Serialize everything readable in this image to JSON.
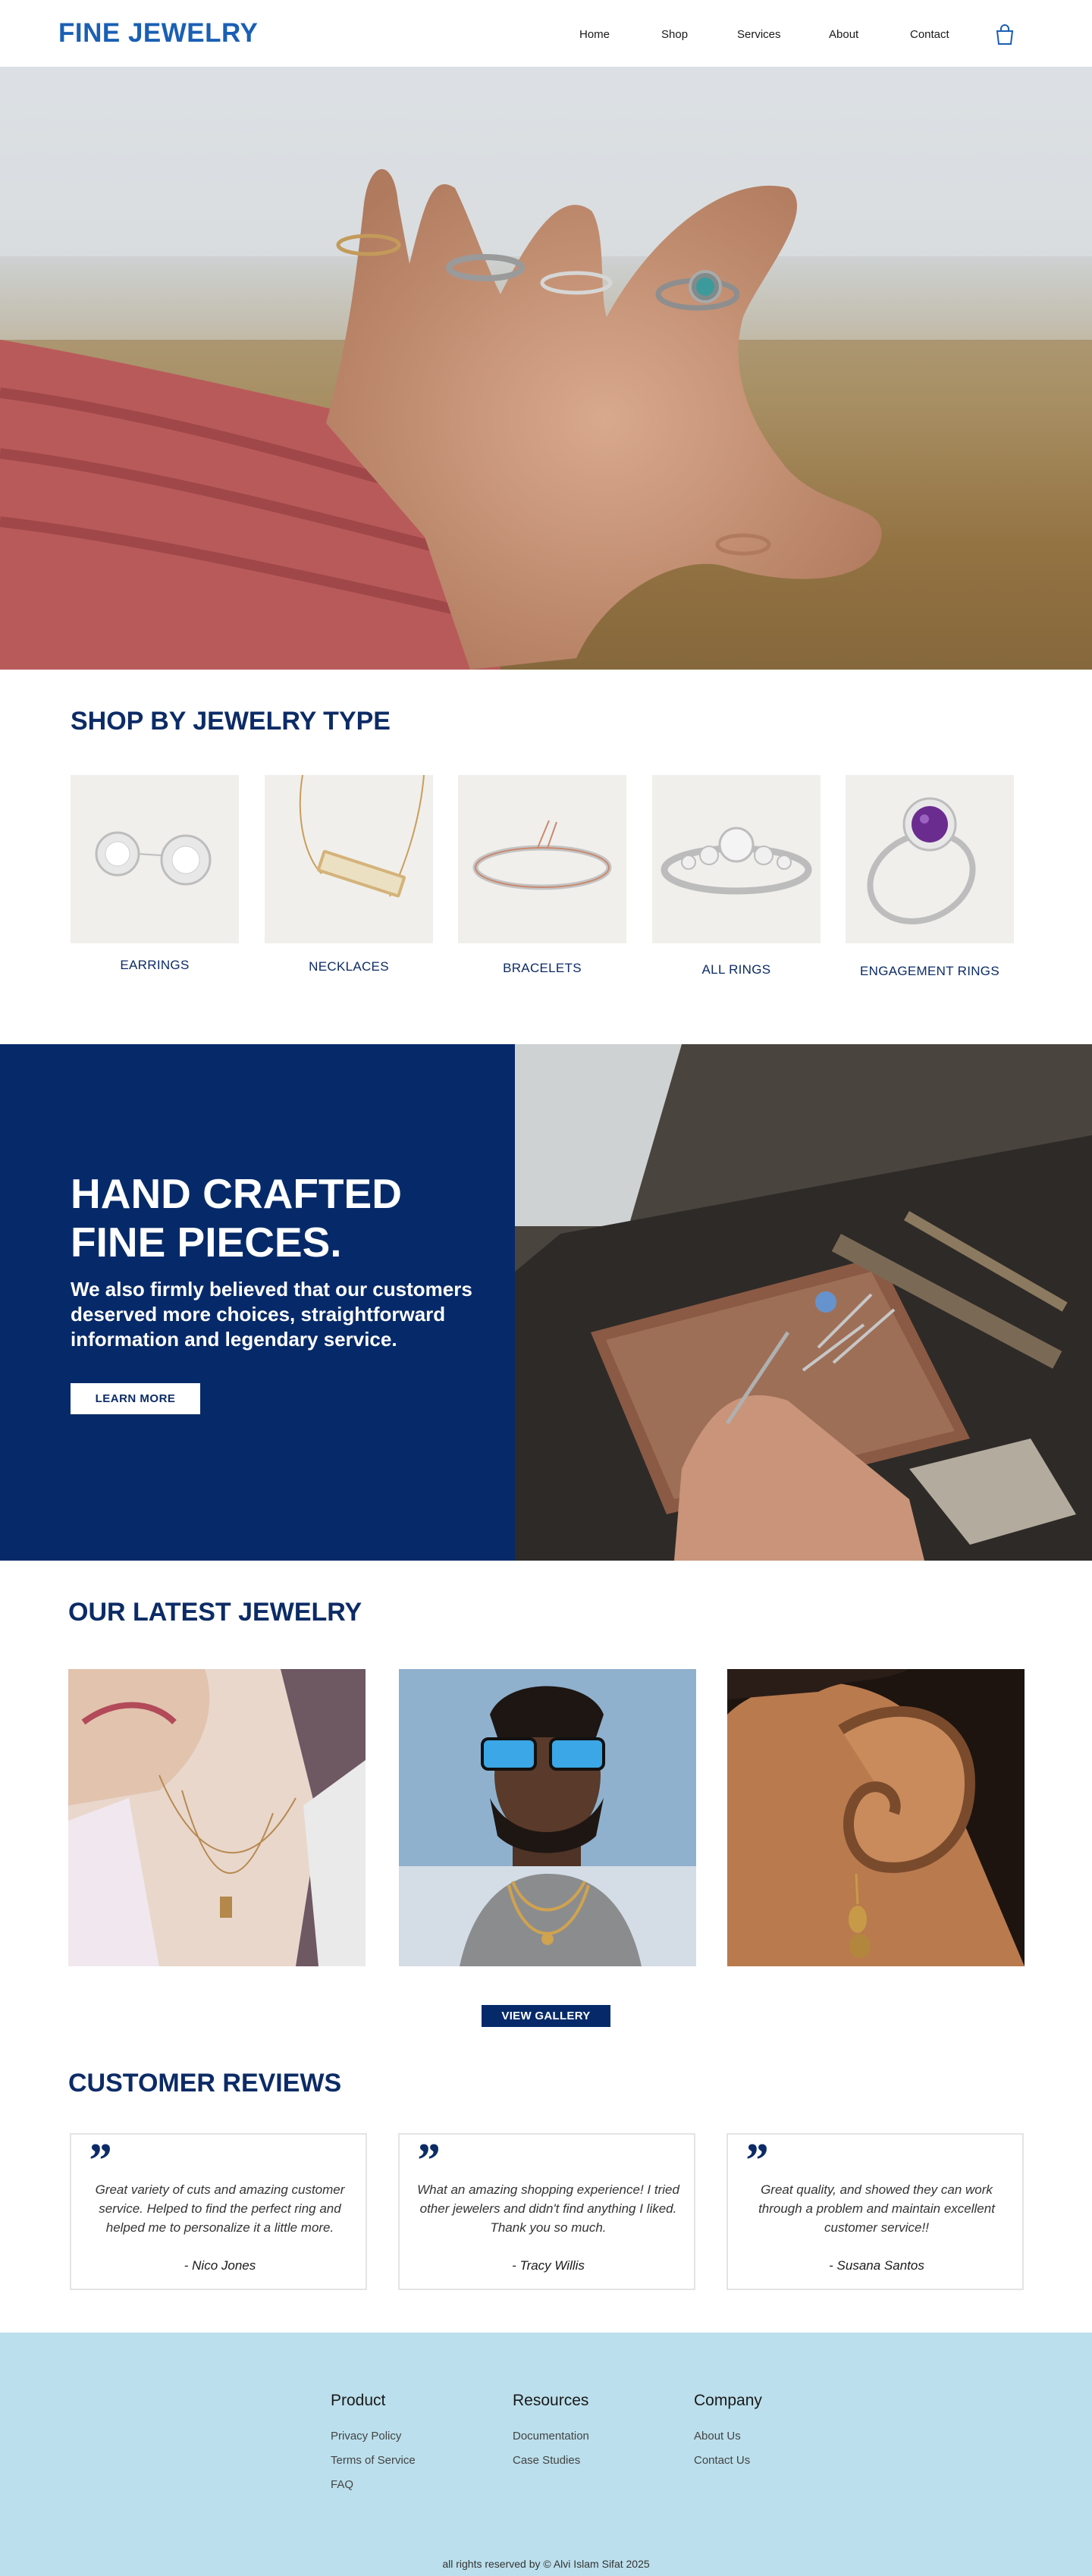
{
  "brand": {
    "name": "FINE JEWELRY",
    "color": "#1a5fb4"
  },
  "nav": {
    "links": [
      "Home",
      "Shop",
      "Services",
      "About",
      "Contact"
    ],
    "cart_icon": "shopping-bag-icon"
  },
  "shop_by": {
    "title": "SHOP BY JEWELRY TYPE",
    "items": [
      {
        "label": "EARRINGS"
      },
      {
        "label": "NECKLACES"
      },
      {
        "label": "BRACELETS"
      },
      {
        "label": "ALL RINGS"
      },
      {
        "label": "ENGAGEMENT RINGS"
      }
    ]
  },
  "craft": {
    "heading_line1": "HAND CRAFTED",
    "heading_line2": "FINE PIECES.",
    "body": "We also firmly believed that our customers deserved more choices, straightforward information and legendary service.",
    "button": "LEARN MORE",
    "bg_color": "#062a69"
  },
  "latest": {
    "title": "OUR LATEST JEWELRY",
    "button": "VIEW GALLERY"
  },
  "reviews": {
    "title": "CUSTOMER REVIEWS",
    "quote_mark": "”",
    "items": [
      {
        "text": "Great variety of cuts and amazing customer service. Helped to find the perfect ring and helped me to personalize it a little more.",
        "author": "- Nico Jones"
      },
      {
        "text": "What an amazing shopping experience! I tried other jewelers and didn't find anything I liked. Thank you so much.",
        "author": "- Tracy Willis"
      },
      {
        "text": "Great quality, and showed they can work through a problem and maintain excellent customer service!!",
        "author": "- Susana Santos"
      }
    ]
  },
  "footer": {
    "columns": [
      {
        "heading": "Product",
        "links": [
          "Privacy Policy",
          "Terms of Service",
          "FAQ"
        ]
      },
      {
        "heading": "Resources",
        "links": [
          "Documentation",
          "Case Studies"
        ]
      },
      {
        "heading": "Company",
        "links": [
          "About Us",
          "Contact Us"
        ]
      }
    ],
    "copyright": "all rights reserved by © Alvi Islam Sifat  2025",
    "bg_color": "#bbdfec"
  }
}
